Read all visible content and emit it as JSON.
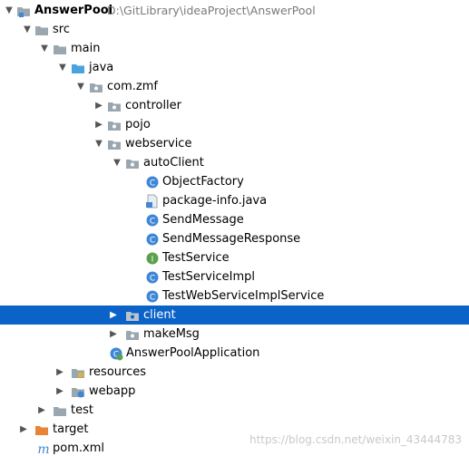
{
  "project": {
    "name": "AnswerPool",
    "path": "D:\\GitLibrary\\ideaProject\\AnswerPool"
  },
  "tree": {
    "src": "src",
    "main": "main",
    "java": "java",
    "package": "com.zmf",
    "controller": "controller",
    "pojo": "pojo",
    "webservice": "webservice",
    "autoClient": "autoClient",
    "files": [
      "ObjectFactory",
      "package-info.java",
      "SendMessage",
      "SendMessageResponse",
      "TestService",
      "TestServiceImpl",
      "TestWebServiceImplService"
    ],
    "client": "client",
    "makeMsg": "makeMsg",
    "app": "AnswerPoolApplication",
    "resources": "resources",
    "webapp": "webapp",
    "test": "test",
    "target": "target",
    "pom": "pom.xml"
  },
  "watermark": "https://blog.csdn.net/weixin_43444783",
  "colors": {
    "selection": "#0b63c7",
    "folder": "#9aa7b0",
    "source_folder": "#4aa3df",
    "excluded_folder": "#e8833a",
    "class_icon": "#3e86d6",
    "interface_icon": "#5aa14f"
  }
}
